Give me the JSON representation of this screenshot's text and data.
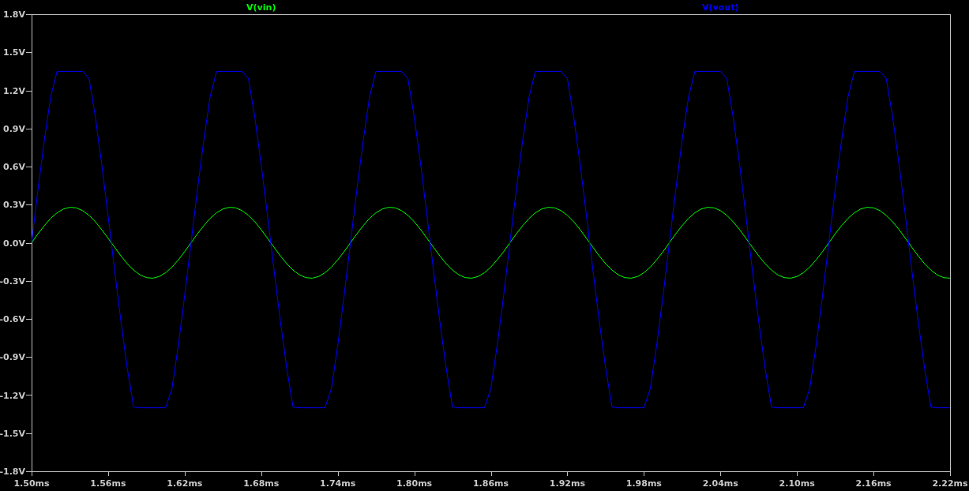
{
  "plot": {
    "chart_data": {
      "type": "line",
      "x": [
        1.5,
        1.505,
        1.51,
        1.515,
        1.52,
        1.525,
        1.53,
        1.535,
        1.54,
        1.545,
        1.55,
        1.555,
        1.56,
        1.565,
        1.57,
        1.575,
        1.58,
        1.585,
        1.59,
        1.595,
        1.6,
        1.605,
        1.61,
        1.615,
        1.62,
        1.625,
        1.63,
        1.635,
        1.64,
        1.645,
        1.65,
        1.655,
        1.66,
        1.665,
        1.67,
        1.675,
        1.68,
        1.685,
        1.69,
        1.695,
        1.7,
        1.705,
        1.71,
        1.715,
        1.72,
        1.725,
        1.73,
        1.735,
        1.74,
        1.745,
        1.75,
        1.755,
        1.76,
        1.765,
        1.77,
        1.775,
        1.78,
        1.785,
        1.79,
        1.795,
        1.8,
        1.805,
        1.81,
        1.815,
        1.82,
        1.825,
        1.83,
        1.835,
        1.84,
        1.845,
        1.85,
        1.855,
        1.86,
        1.865,
        1.87,
        1.875,
        1.88,
        1.885,
        1.89,
        1.895,
        1.9,
        1.905,
        1.91,
        1.915,
        1.92,
        1.925,
        1.93,
        1.935,
        1.94,
        1.945,
        1.95,
        1.955,
        1.96,
        1.965,
        1.97,
        1.975,
        1.98,
        1.985,
        1.99,
        1.995,
        2.0,
        2.005,
        2.01,
        2.015,
        2.02,
        2.025,
        2.03,
        2.035,
        2.04,
        2.045,
        2.05,
        2.055,
        2.06,
        2.065,
        2.07,
        2.075,
        2.08,
        2.085,
        2.09,
        2.095,
        2.1,
        2.105,
        2.11,
        2.115,
        2.12,
        2.125,
        2.13,
        2.135,
        2.14,
        2.145,
        2.15,
        2.155,
        2.16,
        2.165,
        2.17,
        2.175,
        2.18,
        2.185,
        2.19,
        2.195,
        2.2,
        2.205,
        2.21,
        2.215,
        2.22
      ],
      "series": [
        {
          "name": "V(vin)",
          "color": "#00ff00",
          "values": [
            0,
            0.07,
            0.135,
            0.192,
            0.236,
            0.266,
            0.279,
            0.275,
            0.253,
            0.216,
            0.165,
            0.103,
            0.035,
            -0.035,
            -0.103,
            -0.165,
            -0.216,
            -0.253,
            -0.275,
            -0.279,
            -0.266,
            -0.236,
            -0.192,
            -0.135,
            -0.07,
            0,
            0.07,
            0.135,
            0.192,
            0.236,
            0.266,
            0.279,
            0.275,
            0.253,
            0.216,
            0.165,
            0.103,
            0.035,
            -0.035,
            -0.103,
            -0.165,
            -0.216,
            -0.253,
            -0.275,
            -0.279,
            -0.266,
            -0.236,
            -0.192,
            -0.135,
            -0.07,
            0,
            0.07,
            0.135,
            0.192,
            0.236,
            0.266,
            0.279,
            0.275,
            0.253,
            0.216,
            0.165,
            0.103,
            0.035,
            -0.035,
            -0.103,
            -0.165,
            -0.216,
            -0.253,
            -0.275,
            -0.279,
            -0.266,
            -0.236,
            -0.192,
            -0.135,
            -0.07,
            0,
            0.07,
            0.135,
            0.192,
            0.236,
            0.266,
            0.279,
            0.275,
            0.253,
            0.216,
            0.165,
            0.103,
            0.035,
            -0.035,
            -0.103,
            -0.165,
            -0.216,
            -0.253,
            -0.275,
            -0.279,
            -0.266,
            -0.236,
            -0.192,
            -0.135,
            -0.07,
            0,
            0.07,
            0.135,
            0.192,
            0.236,
            0.266,
            0.279,
            0.275,
            0.253,
            0.216,
            0.165,
            0.103,
            0.035,
            -0.035,
            -0.103,
            -0.165,
            -0.216,
            -0.253,
            -0.275,
            -0.279,
            -0.266,
            -0.236,
            -0.192,
            -0.135,
            -0.07,
            0,
            0.07,
            0.135,
            0.192,
            0.236,
            0.266,
            0.279,
            0.275,
            0.253,
            0.216,
            0.165,
            0.103,
            0.035,
            -0.035,
            -0.103,
            -0.165,
            -0.216,
            -0.253,
            -0.275,
            -0.279
          ]
        },
        {
          "name": "V(vout)",
          "color": "#0000ff",
          "values": [
            0,
            0.418,
            0.809,
            1.15,
            1.35,
            1.35,
            1.35,
            1.35,
            1.35,
            1.294,
            0.988,
            0.618,
            0.211,
            -0.211,
            -0.618,
            -0.988,
            -1.294,
            -1.3,
            -1.3,
            -1.3,
            -1.3,
            -1.3,
            -1.15,
            -0.809,
            -0.418,
            0,
            0.418,
            0.809,
            1.15,
            1.35,
            1.35,
            1.35,
            1.35,
            1.35,
            1.294,
            0.988,
            0.618,
            0.211,
            -0.211,
            -0.618,
            -0.988,
            -1.294,
            -1.3,
            -1.3,
            -1.3,
            -1.3,
            -1.3,
            -1.15,
            -0.809,
            -0.418,
            0,
            0.418,
            0.809,
            1.15,
            1.35,
            1.35,
            1.35,
            1.35,
            1.35,
            1.294,
            0.988,
            0.618,
            0.211,
            -0.211,
            -0.618,
            -0.988,
            -1.294,
            -1.3,
            -1.3,
            -1.3,
            -1.3,
            -1.3,
            -1.15,
            -0.809,
            -0.418,
            0,
            0.418,
            0.809,
            1.15,
            1.35,
            1.35,
            1.35,
            1.35,
            1.35,
            1.294,
            0.988,
            0.618,
            0.211,
            -0.211,
            -0.618,
            -0.988,
            -1.294,
            -1.3,
            -1.3,
            -1.3,
            -1.3,
            -1.3,
            -1.15,
            -0.809,
            -0.418,
            0,
            0.418,
            0.809,
            1.15,
            1.35,
            1.35,
            1.35,
            1.35,
            1.35,
            1.294,
            0.988,
            0.618,
            0.211,
            -0.211,
            -0.618,
            -0.988,
            -1.294,
            -1.3,
            -1.3,
            -1.3,
            -1.3,
            -1.3,
            -1.15,
            -0.809,
            -0.418,
            0,
            0.418,
            0.809,
            1.15,
            1.35,
            1.35,
            1.35,
            1.35,
            1.35,
            1.294,
            0.988,
            0.618,
            0.211,
            -0.211,
            -0.618,
            -0.988,
            -1.294,
            -1.3,
            -1.3,
            -1.3
          ]
        }
      ],
      "xlim": [
        1.5,
        2.22
      ],
      "ylim": [
        -1.8,
        1.8
      ],
      "xticks": [
        {
          "value": 1.5,
          "label": "1.50ms"
        },
        {
          "value": 1.56,
          "label": "1.56ms"
        },
        {
          "value": 1.62,
          "label": "1.62ms"
        },
        {
          "value": 1.68,
          "label": "1.68ms"
        },
        {
          "value": 1.74,
          "label": "1.74ms"
        },
        {
          "value": 1.8,
          "label": "1.80ms"
        },
        {
          "value": 1.86,
          "label": "1.86ms"
        },
        {
          "value": 1.92,
          "label": "1.92ms"
        },
        {
          "value": 1.98,
          "label": "1.98ms"
        },
        {
          "value": 2.04,
          "label": "2.04ms"
        },
        {
          "value": 2.1,
          "label": "2.10ms"
        },
        {
          "value": 2.16,
          "label": "2.16ms"
        },
        {
          "value": 2.22,
          "label": "2.22ms"
        }
      ],
      "yticks": [
        {
          "value": 1.8,
          "label": "1.8V"
        },
        {
          "value": 1.5,
          "label": "1.5V"
        },
        {
          "value": 1.2,
          "label": "1.2V"
        },
        {
          "value": 0.9,
          "label": "0.9V"
        },
        {
          "value": 0.6,
          "label": "0.6V"
        },
        {
          "value": 0.3,
          "label": "0.3V"
        },
        {
          "value": 0,
          "label": "0.0V"
        },
        {
          "value": -0.3,
          "label": "-0.3V"
        },
        {
          "value": -0.6,
          "label": "-0.6V"
        },
        {
          "value": -0.9,
          "label": "-0.9V"
        },
        {
          "value": -1.2,
          "label": "-1.2V"
        },
        {
          "value": -1.5,
          "label": "-1.5V"
        },
        {
          "value": -1.8,
          "label": "-1.8V"
        }
      ]
    }
  }
}
